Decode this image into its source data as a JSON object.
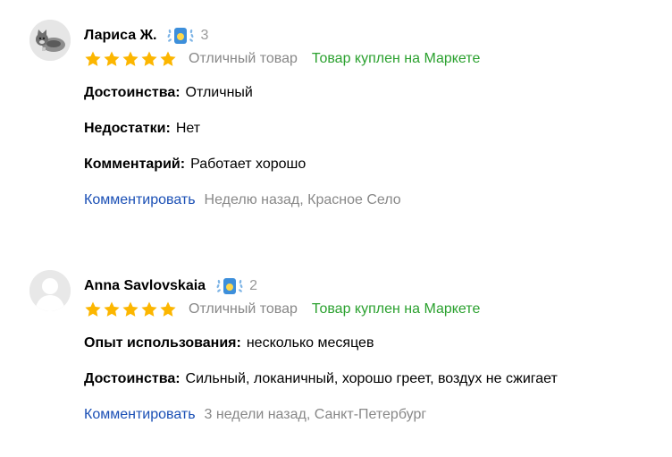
{
  "reviews": [
    {
      "author": "Лариса Ж.",
      "badge_count": "3",
      "avatar": "cat-photo",
      "stars": 5,
      "rating_text": "Отличный товар",
      "verified": "Товар куплен на Маркете",
      "fields": [
        {
          "label": "Достоинства:",
          "value": "Отличный"
        },
        {
          "label": "Недостатки:",
          "value": "Нет"
        },
        {
          "label": "Комментарий:",
          "value": "Работает хорошо"
        }
      ],
      "comment_link": "Комментировать",
      "meta": "Неделю назад, Красное Село"
    },
    {
      "author": "Anna Savlovskaia",
      "badge_count": "2",
      "avatar": "default-user",
      "stars": 5,
      "rating_text": "Отличный товар",
      "verified": "Товар куплен на Маркете",
      "fields": [
        {
          "label": "Опыт использования:",
          "value": "несколько месяцев"
        },
        {
          "label": "Достоинства:",
          "value": "Сильный, локаничный, хорошо греет, воздух не сжигает"
        }
      ],
      "comment_link": "Комментировать",
      "meta": "3 недели назад, Санкт-Петербург"
    }
  ],
  "colors": {
    "star": "#fcb600",
    "verified": "#2ba12f",
    "link": "#1a4fb5",
    "muted": "#888888"
  }
}
